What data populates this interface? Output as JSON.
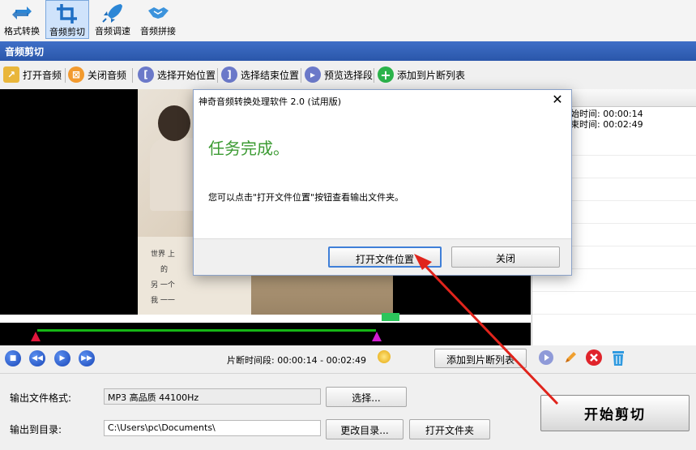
{
  "toolbar": {
    "items": [
      {
        "label": "格式转换",
        "icon": "convert-icon",
        "active": false
      },
      {
        "label": "音频剪切",
        "icon": "crop-icon",
        "active": true
      },
      {
        "label": "音频调速",
        "icon": "rocket-icon",
        "active": false
      },
      {
        "label": "音频拼接",
        "icon": "handshake-icon",
        "active": false
      }
    ]
  },
  "section": {
    "title": "音频剪切"
  },
  "actions": {
    "open_audio": "打开音频",
    "close_audio": "关闭音频",
    "select_start": "选择开始位置",
    "select_end": "选择结束位置",
    "preview_segment": "预览选择段",
    "add_to_list": "添加到片断列表"
  },
  "poster": {
    "text_lines": [
      "世界 上",
      "的",
      "另 一个",
      "我 一一"
    ]
  },
  "segment_list": {
    "header": "",
    "start_label": "始时间:",
    "start_value": "00:00:14",
    "end_label": "束时间:",
    "end_value": "00:02:49"
  },
  "controls": {
    "segment_label": "片断时间段:",
    "segment_value": "00:00:14 - 00:02:49",
    "add_to_list_button": "添加到片断列表"
  },
  "output": {
    "format_label": "输出文件格式:",
    "format_value": "MP3 高品质 44100Hz",
    "select_button": "选择...",
    "dir_label": "输出到目录:",
    "dir_value": "C:\\Users\\pc\\Documents\\",
    "change_dir_button": "更改目录...",
    "open_folder_button": "打开文件夹"
  },
  "start_button": "开始剪切",
  "dialog": {
    "title": "神奇音频转换处理软件 2.0 (试用版)",
    "close_glyph": "✕",
    "heading": "任务完成。",
    "message": "您可以点击\"打开文件位置\"按钮查看输出文件夹。",
    "open_location_button": "打开文件位置",
    "close_button": "关闭"
  },
  "colors": {
    "accent_blue": "#2a56aa",
    "success_green": "#3c9b33",
    "arrow_red": "#e0241c"
  }
}
